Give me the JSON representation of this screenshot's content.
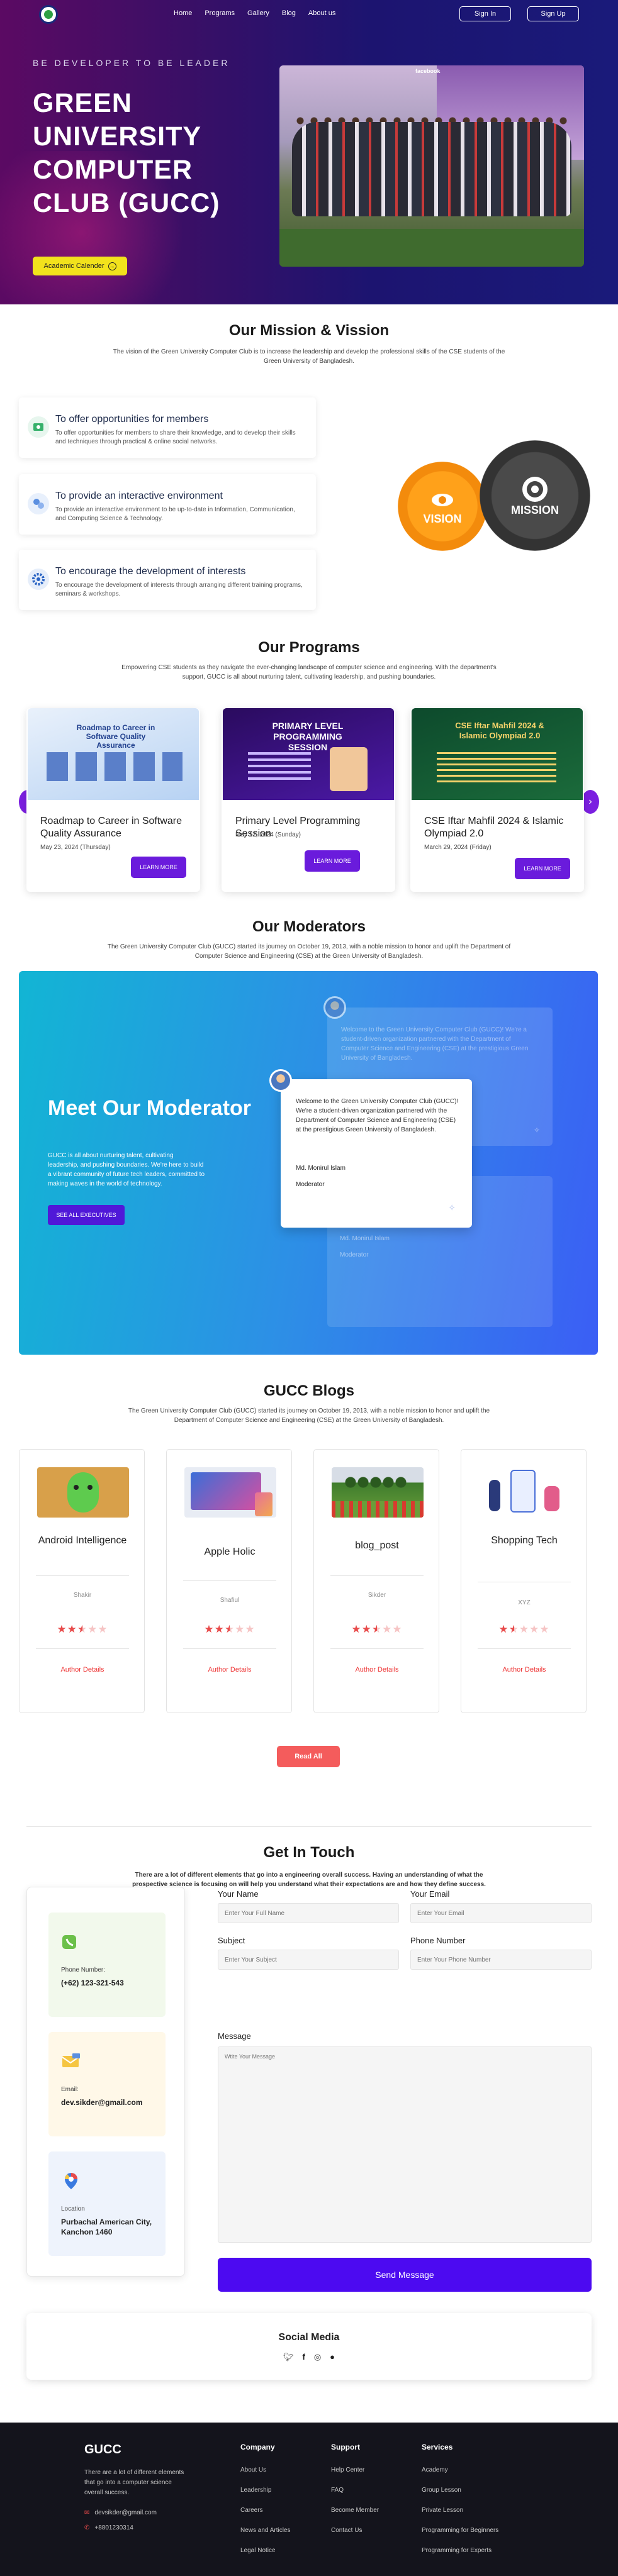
{
  "nav": {
    "links": [
      "Home",
      "Programs",
      "Gallery",
      "Blog",
      "About us"
    ],
    "signin": "Sign In",
    "signup": "Sign Up"
  },
  "hero": {
    "tagline": "BE DEVELOPER TO BE LEADER",
    "title": "GREEN UNIVERSITY COMPUTER CLUB (GUCC)",
    "calendar_btn": "Academic Calender",
    "photo_overlay": "facebook"
  },
  "mission": {
    "heading": "Our Mission & Vission",
    "intro": "The vision of the Green University Computer Club is to increase the leadership and develop the professional skills of the CSE students of the Green University of Bangladesh.",
    "items": [
      {
        "title": "To offer opportunities for members",
        "desc": "To offer opportunities for members to share their knowledge, and to develop their skills and techniques through practical & online social networks."
      },
      {
        "title": "To provide an interactive environment",
        "desc": "To provide an interactive environment to be up-to-date in Information, Communication, and Computing Science & Technology."
      },
      {
        "title": "To encourage the development of interests",
        "desc": "To encourage the development of interests through arranging different training programs, seminars & workshops."
      }
    ],
    "gear_vision": "VISION",
    "gear_mission": "MISSION"
  },
  "programs": {
    "heading": "Our Programs",
    "intro": "Empowering CSE students as they navigate the ever-changing landscape of computer science and engineering. With the department's support, GUCC is all about nurturing talent, cultivating leadership, and pushing boundaries.",
    "cards": [
      {
        "poster_head": "Roadmap to Career in Software Quality Assurance",
        "title": "Roadmap to Career in Software Quality Assurance",
        "date": "May 23, 2024 (Thursday)",
        "btn": "LEARN MORE"
      },
      {
        "poster_head": "PRIMARY LEVEL PROGRAMMING SESSION",
        "title": "Primary Level Programming Session",
        "date": "May 12, 2024 (Sunday)",
        "btn": "LEARN MORE"
      },
      {
        "poster_head": "CSE Iftar Mahfil 2024 & Islamic Olympiad 2.0",
        "title": "CSE Iftar Mahfil 2024 & Islamic Olympiad 2.0",
        "date": "March 29, 2024 (Friday)",
        "btn": "LEARN MORE"
      }
    ]
  },
  "moderators": {
    "heading": "Our Moderators",
    "intro": "The Green University Computer Club (GUCC) started its journey on October 19, 2013, with a noble mission to honor and uplift the Department of Computer Science and Engineering (CSE) at the Green University of Bangladesh.",
    "panel_title": "Meet Our Moderator",
    "panel_text": "GUCC is all about nurturing talent, cultivating leadership, and pushing boundaries. We're here to build a vibrant community of future tech leaders, committed to making waves in the world of technology.",
    "panel_btn": "SEE ALL EXECUTIVES",
    "back_quote": "Welcome to the Green University Computer Club (GUCC)! We're a student-driven organization partnered with the Department of Computer Science and Engineering (CSE) at the prestigious Green University of Bangladesh.",
    "quote": "Welcome to the Green University Computer Club (GUCC)! We're a student-driven organization partnered with the Department of Computer Science and Engineering (CSE) at the prestigious Green University of Bangladesh.",
    "name": "Md. Monirul Islam",
    "role": "Moderator",
    "faded_name": "Md. Monirul Islam",
    "faded_role": "Moderator"
  },
  "blogs": {
    "heading": "GUCC Blogs",
    "intro": "The Green University Computer Club (GUCC) started its journey on October 19, 2013, with a noble mission to honor and uplift the Department of Computer Science and Engineering (CSE) at the Green University of Bangladesh.",
    "cards": [
      {
        "title": "Android Intelligence",
        "author": "Shakir",
        "rating": 2.5,
        "link": "Author Details"
      },
      {
        "title": "Apple Holic",
        "author": "Shafiul",
        "rating": 2.5,
        "link": "Author Details"
      },
      {
        "title": "blog_post",
        "author": "Sikder",
        "rating": 2.5,
        "link": "Author Details"
      },
      {
        "title": "Shopping Tech",
        "author": "XYZ",
        "rating": 1.5,
        "link": "Author Details"
      }
    ],
    "read_all": "Read All"
  },
  "contact": {
    "heading": "Get In Touch",
    "intro": "There are a lot of different elements that go into a engineering overall success. Having an understanding of what the prospective science is focusing on will help you understand what their expectations are and how they define success.",
    "phone_label": "Phone Number:",
    "phone": "(+62) 123-321-543",
    "email_label": "Email:",
    "email": "dev.sikder@gmail.com",
    "location_label": "Location",
    "location": "Purbachal American City, Kanchon 1460",
    "name_label": "Your Name",
    "name_ph": "Enter Your Full Name",
    "email_field_label": "Your Email",
    "email_ph": "Enter Your Email",
    "subject_label": "Subject",
    "subject_ph": "Enter Your Subject",
    "phone_field_label": "Phone Number",
    "phone_ph": "Enter Your Phone Number",
    "message_label": "Message",
    "message_ph": "Wtite Your Message",
    "send": "Send Message"
  },
  "social": {
    "heading": "Social Media",
    "icons": [
      "twitter-icon",
      "facebook-icon",
      "instagram-icon",
      "github-icon"
    ]
  },
  "footer": {
    "brand": "GUCC",
    "desc": "There are a lot of different elements that go into a computer science overall success.",
    "email": "devsikder@gmail.com",
    "phone": "+8801230314",
    "company": {
      "title": "Company",
      "items": [
        "About Us",
        "Leadership",
        "Careers",
        "News and Articles",
        "Legal Notice"
      ]
    },
    "support": {
      "title": "Support",
      "items": [
        "Help Center",
        "FAQ",
        "Become Member",
        "Contact Us"
      ]
    },
    "services": {
      "title": "Services",
      "items": [
        "Academy",
        "Group Lesson",
        "Private Lesson",
        "Programming for Beginners",
        "Programming for Experts"
      ]
    }
  },
  "colors": {
    "accent": "#6a1bdc",
    "send": "#4c0af1",
    "readall": "#f45c5c",
    "star": "#e84a4a",
    "calendar": "#f2e21c"
  }
}
